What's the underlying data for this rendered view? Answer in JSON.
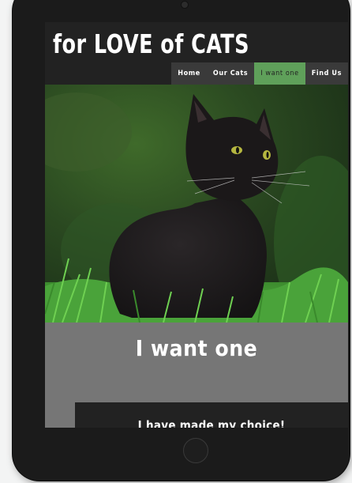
{
  "site": {
    "logo": "for LOVE of CATS"
  },
  "nav": {
    "items": [
      {
        "label": "Home",
        "active": false
      },
      {
        "label": "Our Cats",
        "active": false
      },
      {
        "label": "I want one",
        "active": true
      },
      {
        "label": "Find Us",
        "active": false
      }
    ]
  },
  "hero": {
    "image": "black-cat-in-grass-photo"
  },
  "main": {
    "title": "I want one",
    "choice_heading": "I have made my choice!"
  },
  "colors": {
    "accent": "#5fa05a",
    "band": "#767676",
    "header": "#222222"
  }
}
